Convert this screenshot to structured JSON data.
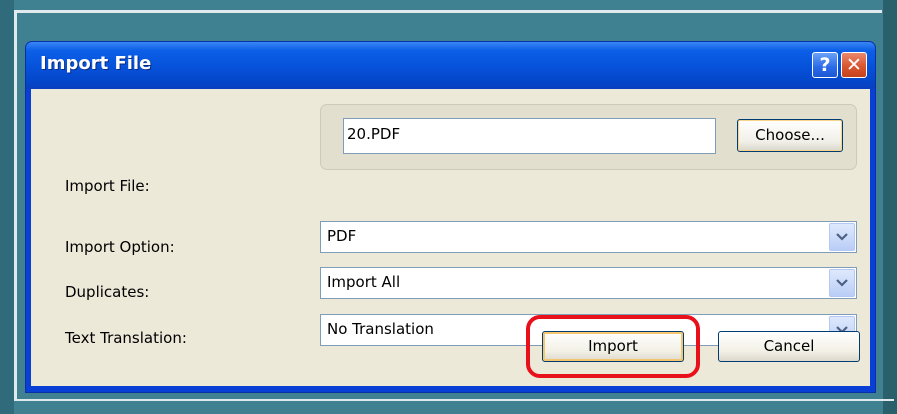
{
  "dialog": {
    "title": "Import File",
    "help_glyph": "?",
    "close_glyph": "✕"
  },
  "form": {
    "import_file_label": "Import File:",
    "import_file_value": "20.PDF",
    "choose_label": "Choose...",
    "import_option_label": "Import Option:",
    "import_option_value": "PDF",
    "duplicates_label": "Duplicates:",
    "duplicates_value": "Import All",
    "text_translation_label": "Text Translation:",
    "text_translation_value": "No Translation"
  },
  "buttons": {
    "import_label": "Import",
    "cancel_label": "Cancel"
  },
  "colors": {
    "titlebar": "#0651d9",
    "client_background": "#ece9d8",
    "highlight": "#e8101a",
    "frame": "#3f8091"
  }
}
